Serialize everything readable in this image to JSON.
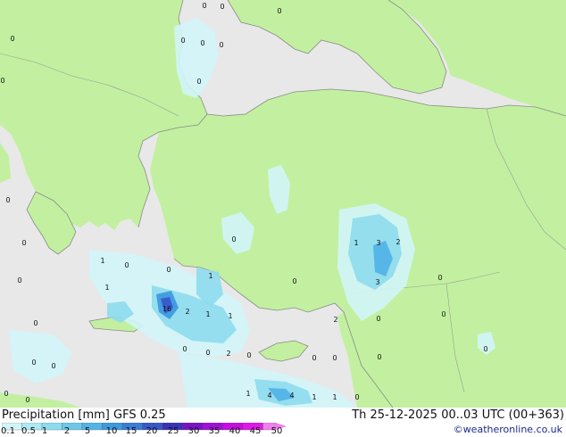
{
  "footer": {
    "title": "Precipitation [mm] GFS 0.25",
    "datetime": "Th 25-12-2025 00..03 UTC (00+363)",
    "credit": "©weatheronline.co.uk"
  },
  "legend": {
    "ticks": [
      "0.1",
      "0.5",
      "1",
      "2",
      "5",
      "10",
      "15",
      "20",
      "25",
      "30",
      "35",
      "40",
      "45",
      "50"
    ],
    "colors": [
      "#d2f5fa",
      "#aeeaf3",
      "#8ddced",
      "#6dc8e8",
      "#52b3e6",
      "#3e99df",
      "#3a7cd6",
      "#3858c8",
      "#3a33b8",
      "#7a12c8",
      "#a10fd8",
      "#c40fe0",
      "#e018e8",
      "#f080f0"
    ]
  },
  "map_colors": {
    "sea": "#e8e8e8",
    "land": "#c2f0a0",
    "coast": "#8a8a8a"
  },
  "values": [
    "0",
    "0",
    "0",
    "0",
    "0",
    "0",
    "0",
    "0",
    "0",
    "0",
    "0",
    "0",
    "0",
    "0",
    "0",
    "0",
    "0",
    "1",
    "0",
    "1",
    "0",
    "1",
    "0",
    "16",
    "2",
    "1",
    "1",
    "0",
    "0",
    "2",
    "0",
    "0",
    "0",
    "0",
    "1",
    "4",
    "4",
    "1",
    "1",
    "0",
    "1",
    "3",
    "2",
    "3",
    "0",
    "2",
    "0",
    "0",
    "0",
    "0"
  ]
}
